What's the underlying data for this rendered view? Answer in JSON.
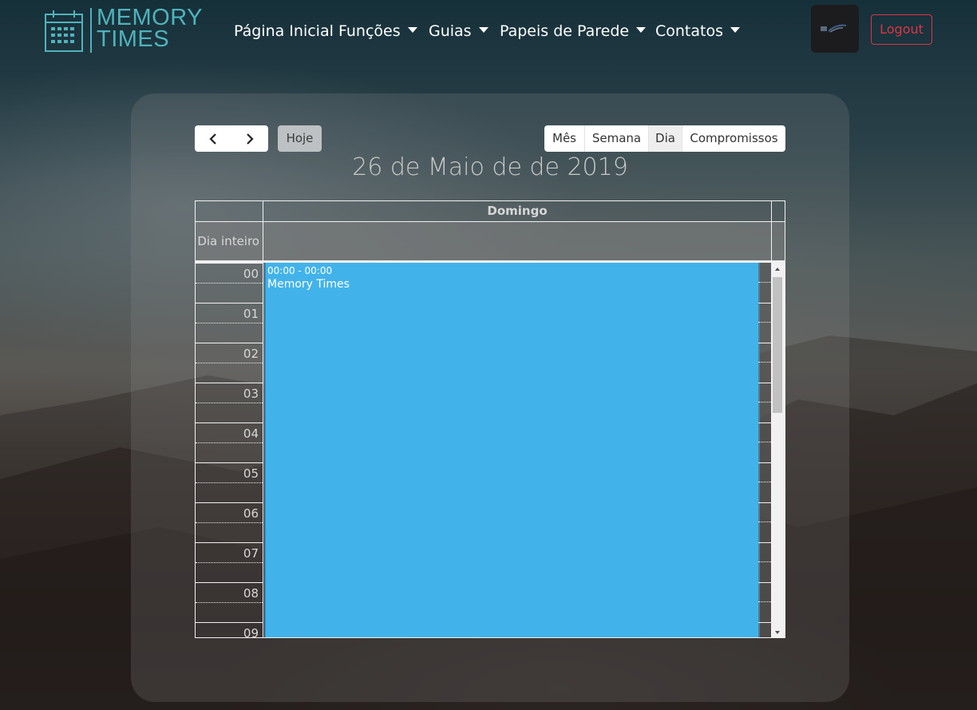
{
  "brand": {
    "line1": "MEMORY",
    "line2": "TIMES",
    "icon": "calendar-icon"
  },
  "nav": [
    {
      "label": "Página Inicial",
      "dropdown": false
    },
    {
      "label": "Funções",
      "dropdown": true
    },
    {
      "label": "Guias",
      "dropdown": true
    },
    {
      "label": "Papeis de Parede",
      "dropdown": true
    },
    {
      "label": "Contatos",
      "dropdown": true
    }
  ],
  "user": {
    "avatar_icon": "user-avatar-logo",
    "logout_label": "Logout"
  },
  "toolbar": {
    "prev_icon": "chevron-left-icon",
    "next_icon": "chevron-right-icon",
    "today_label": "Hoje",
    "views": [
      "Mês",
      "Semana",
      "Dia",
      "Compromissos"
    ],
    "active_view": "Dia"
  },
  "calendar": {
    "title": "26 de Maio de de 2019",
    "day_header": "Domingo",
    "allday_label": "Dia inteiro",
    "hours": [
      "00",
      "01",
      "02",
      "03",
      "04",
      "05",
      "06",
      "07",
      "08",
      "09"
    ],
    "event": {
      "time": "00:00 - 00:00",
      "title": "Memory Times"
    }
  },
  "colors": {
    "brand_teal": "#4fb3bc",
    "event_blue": "#42b3ea",
    "logout_red": "#dc3545"
  }
}
